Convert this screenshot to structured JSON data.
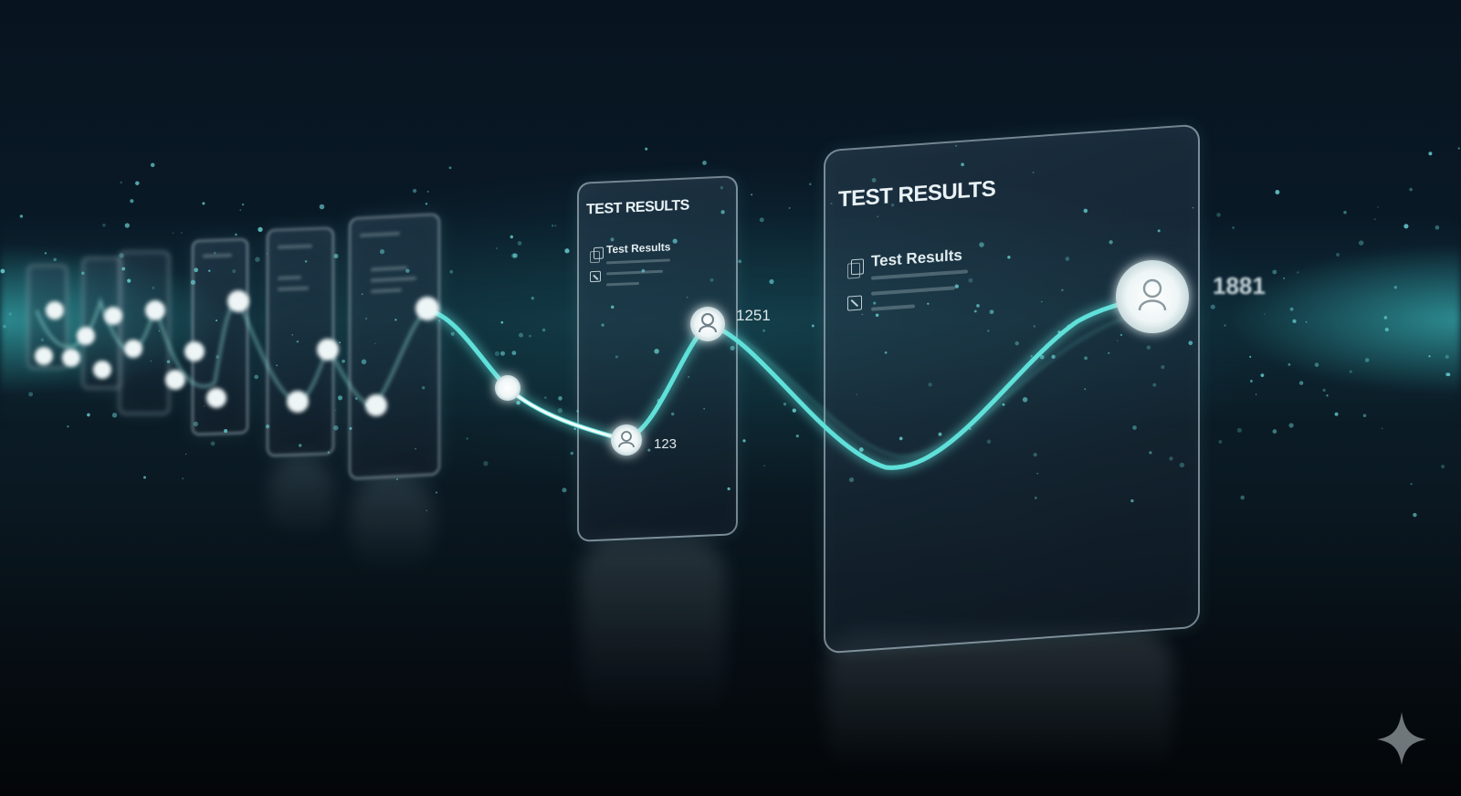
{
  "panels": [
    {
      "title": "TEST RESULTS",
      "subtitle": "Test Results"
    },
    {
      "title": "TEST RESULTS",
      "subtitle": "Test Results"
    }
  ],
  "node_labels": [
    "1251",
    "123",
    "1881"
  ],
  "colors": {
    "background": "#050b12",
    "accent_cyan": "#5fe0d9",
    "node_white": "#f4f8f9"
  },
  "icons": [
    "user-icon",
    "document-icon",
    "checkbox-icon",
    "sparkle-icon"
  ]
}
